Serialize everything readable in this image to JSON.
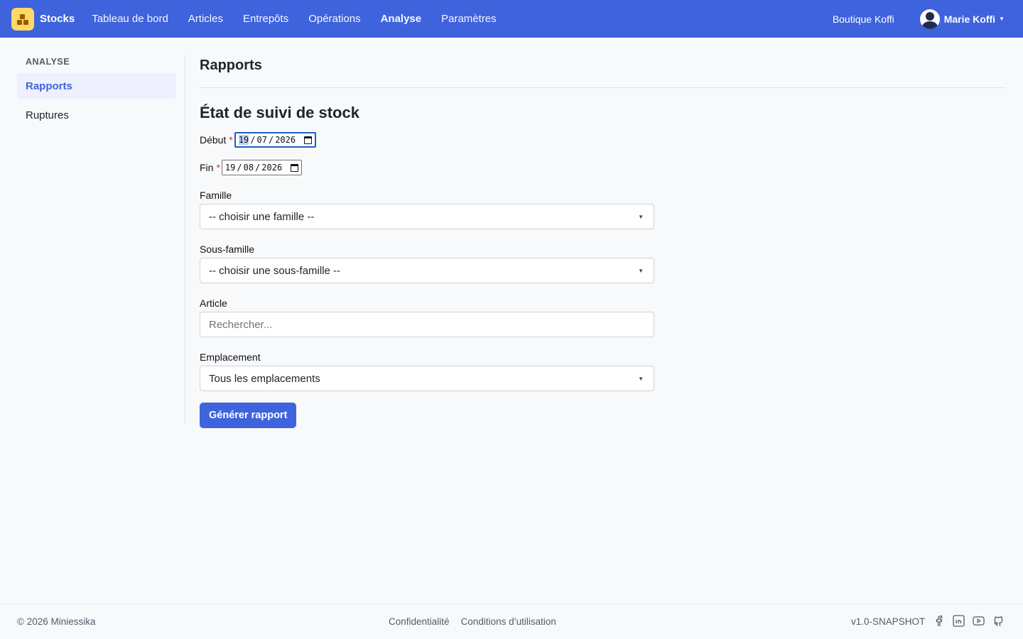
{
  "navbar": {
    "brand": "Stocks",
    "links": [
      "Tableau de bord",
      "Articles",
      "Entrepôts",
      "Opérations",
      "Analyse",
      "Paramètres"
    ],
    "active_link": "Analyse",
    "shop": "Boutique Koffi",
    "user": "Marie Koffi"
  },
  "sidebar": {
    "heading": "ANALYSE",
    "items": [
      {
        "label": "Rapports",
        "active": true
      },
      {
        "label": "Ruptures",
        "active": false
      }
    ]
  },
  "main": {
    "page_title": "Rapports",
    "section_title": "État de suivi de stock",
    "start": {
      "label": "Début",
      "required": "*",
      "day": "19",
      "month": "07",
      "year": "2026"
    },
    "end": {
      "label": "Fin",
      "required": "*",
      "day": "19",
      "month": "08",
      "year": "2026"
    },
    "family": {
      "label": "Famille",
      "value": "-- choisir une famille --"
    },
    "subfamily": {
      "label": "Sous-famille",
      "value": "-- choisir une sous-famille --"
    },
    "article": {
      "label": "Article",
      "placeholder": "Rechercher..."
    },
    "location": {
      "label": "Emplacement",
      "value": "Tous les emplacements"
    },
    "submit": "Générer rapport"
  },
  "footer": {
    "copyright": "© 2026 Miniessika",
    "links": [
      "Confidentialité",
      "Conditions d’utilisation"
    ],
    "version": "v1.0-SNAPSHOT",
    "socials": [
      "facebook-icon",
      "linkedin-icon",
      "youtube-icon",
      "github-icon"
    ]
  },
  "colors": {
    "primary": "#3e63dd",
    "logo": "#ffd866",
    "required": "#d93025"
  }
}
